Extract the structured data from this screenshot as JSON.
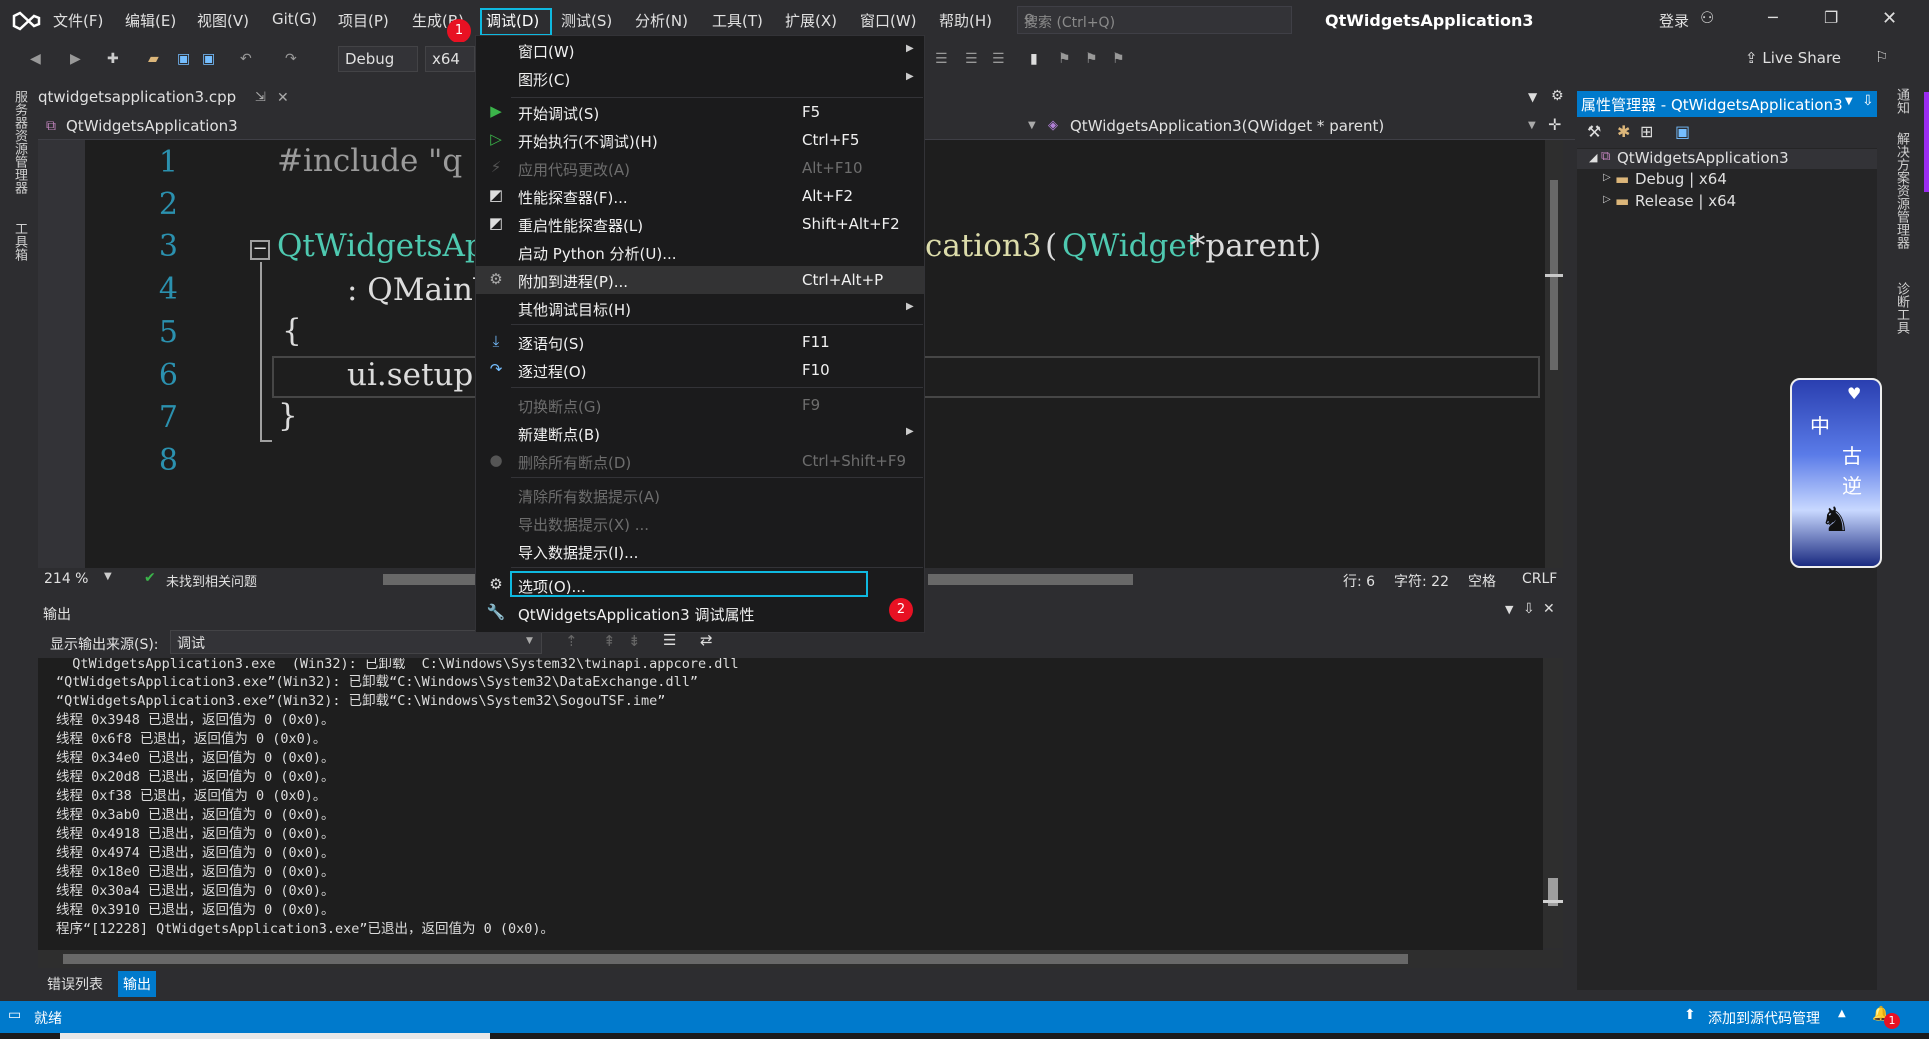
{
  "menubar": {
    "items": [
      "文件(F)",
      "编辑(E)",
      "视图(V)",
      "Git(G)",
      "项目(P)",
      "生成(B)",
      "调试(D)",
      "测试(S)",
      "分析(N)",
      "工具(T)",
      "扩展(X)",
      "窗口(W)",
      "帮助(H)"
    ],
    "search_placeholder": "搜索 (Ctrl+Q)",
    "solution_title": "QtWidgetsApplication3",
    "login": "登录"
  },
  "toolbar": {
    "config": "Debug",
    "platform": "x64",
    "live_share": "Live Share"
  },
  "left_strip": {
    "server_explorer": "服务器资源管理器",
    "toolbox": "工具箱"
  },
  "right_strip": {
    "notifications": "通知",
    "solution_explorer": "解决方案资源管理器",
    "diagnostics": "诊断工具"
  },
  "editor": {
    "tab_name": "qtwidgetsapplication3.cpp",
    "tab_pin": "⇲",
    "nav_project": "QtWidgetsApplication3",
    "nav_member": "QtWidgetsApplication3(QWidget * parent)",
    "line_numbers": [
      "1",
      "2",
      "3",
      "4",
      "5",
      "6",
      "7",
      "8"
    ],
    "code": {
      "l1": "#include \"q",
      "l3a": "QtWidgetsApp",
      "l3b": "cation3",
      "l3c": "(",
      "l3d": "QWidget",
      "l3e": " *parent)",
      "l4": ": QMainW",
      "l5": "{",
      "l6": "ui.setup",
      "l7": "}"
    },
    "zoom": "214 %",
    "issues": "未找到相关问题",
    "position": {
      "line": "行: 6",
      "col": "字符: 22",
      "spaces": "空格",
      "eol": "CRLF"
    }
  },
  "debug_menu": {
    "items": [
      {
        "label": "窗口(W)",
        "shortcut": "",
        "submenu": true,
        "disabled": false,
        "icon": ""
      },
      {
        "label": "图形(C)",
        "shortcut": "",
        "submenu": true,
        "disabled": false,
        "icon": ""
      },
      {
        "label": "开始调试(S)",
        "shortcut": "F5",
        "submenu": false,
        "disabled": false,
        "icon": "play-icon"
      },
      {
        "label": "开始执行(不调试)(H)",
        "shortcut": "Ctrl+F5",
        "submenu": false,
        "disabled": false,
        "icon": "play-outline-icon"
      },
      {
        "label": "应用代码更改(A)",
        "shortcut": "Alt+F10",
        "submenu": false,
        "disabled": true,
        "icon": "hot-reload-icon"
      },
      {
        "label": "性能探查器(F)...",
        "shortcut": "Alt+F2",
        "submenu": false,
        "disabled": false,
        "icon": "profiler-icon"
      },
      {
        "label": "重启性能探查器(L)",
        "shortcut": "Shift+Alt+F2",
        "submenu": false,
        "disabled": false,
        "icon": "profiler-icon"
      },
      {
        "label": "启动 Python 分析(U)...",
        "shortcut": "",
        "submenu": false,
        "disabled": false,
        "icon": ""
      },
      {
        "label": "附加到进程(P)...",
        "shortcut": "Ctrl+Alt+P",
        "submenu": false,
        "disabled": false,
        "icon": "attach-icon"
      },
      {
        "label": "其他调试目标(H)",
        "shortcut": "",
        "submenu": true,
        "disabled": false,
        "icon": ""
      },
      {
        "label": "逐语句(S)",
        "shortcut": "F11",
        "submenu": false,
        "disabled": false,
        "icon": "step-into-icon"
      },
      {
        "label": "逐过程(O)",
        "shortcut": "F10",
        "submenu": false,
        "disabled": false,
        "icon": "step-over-icon"
      },
      {
        "label": "切换断点(G)",
        "shortcut": "F9",
        "submenu": false,
        "disabled": true,
        "icon": ""
      },
      {
        "label": "新建断点(B)",
        "shortcut": "",
        "submenu": true,
        "disabled": false,
        "icon": ""
      },
      {
        "label": "删除所有断点(D)",
        "shortcut": "Ctrl+Shift+F9",
        "submenu": false,
        "disabled": true,
        "icon": "breakpoints-icon"
      },
      {
        "label": "清除所有数据提示(A)",
        "shortcut": "",
        "submenu": false,
        "disabled": true,
        "icon": ""
      },
      {
        "label": "导出数据提示(X) ...",
        "shortcut": "",
        "submenu": false,
        "disabled": true,
        "icon": ""
      },
      {
        "label": "导入数据提示(I)...",
        "shortcut": "",
        "submenu": false,
        "disabled": false,
        "icon": ""
      },
      {
        "label": "选项(O)...",
        "shortcut": "",
        "submenu": false,
        "disabled": false,
        "icon": "gear-icon"
      },
      {
        "label": "QtWidgetsApplication3 调试属性",
        "shortcut": "",
        "submenu": false,
        "disabled": false,
        "icon": "wrench-icon"
      }
    ]
  },
  "badges": {
    "one": "1",
    "two": "2"
  },
  "output": {
    "title": "输出",
    "source_label": "显示输出来源(S):",
    "source_value": "调试",
    "lines": [
      "  QtWidgetsApplication3.exe  (Win32): 已卸载  C:\\Windows\\System32\\twinapi.appcore.dll",
      "“QtWidgetsApplication3.exe”(Win32): 已卸载“C:\\Windows\\System32\\DataExchange.dll”",
      "“QtWidgetsApplication3.exe”(Win32): 已卸载“C:\\Windows\\System32\\SogouTSF.ime”",
      "线程 0x3948 已退出，返回值为 0 (0x0)。",
      "线程 0x6f8 已退出，返回值为 0 (0x0)。",
      "线程 0x34e0 已退出，返回值为 0 (0x0)。",
      "线程 0x20d8 已退出，返回值为 0 (0x0)。",
      "线程 0xf38 已退出，返回值为 0 (0x0)。",
      "线程 0x3ab0 已退出，返回值为 0 (0x0)。",
      "线程 0x4918 已退出，返回值为 0 (0x0)。",
      "线程 0x4974 已退出，返回值为 0 (0x0)。",
      "线程 0x18e0 已退出，返回值为 0 (0x0)。",
      "线程 0x30a4 已退出，返回值为 0 (0x0)。",
      "线程 0x3910 已退出，返回值为 0 (0x0)。",
      "程序“[12228] QtWidgetsApplication3.exe”已退出，返回值为 0 (0x0)。"
    ]
  },
  "bottom_tabs": {
    "errors": "错误列表",
    "output": "输出"
  },
  "properties": {
    "title": "属性管理器 - QtWidgetsApplication3",
    "root": "QtWidgetsApplication3",
    "children": [
      "Debug | x64",
      "Release | x64"
    ]
  },
  "statusbar": {
    "ready": "就绪",
    "source_control": "添加到源代码管理",
    "notif_count": "1"
  },
  "widget_text": {
    "a": "中",
    "b": "古",
    "c": "逆"
  }
}
